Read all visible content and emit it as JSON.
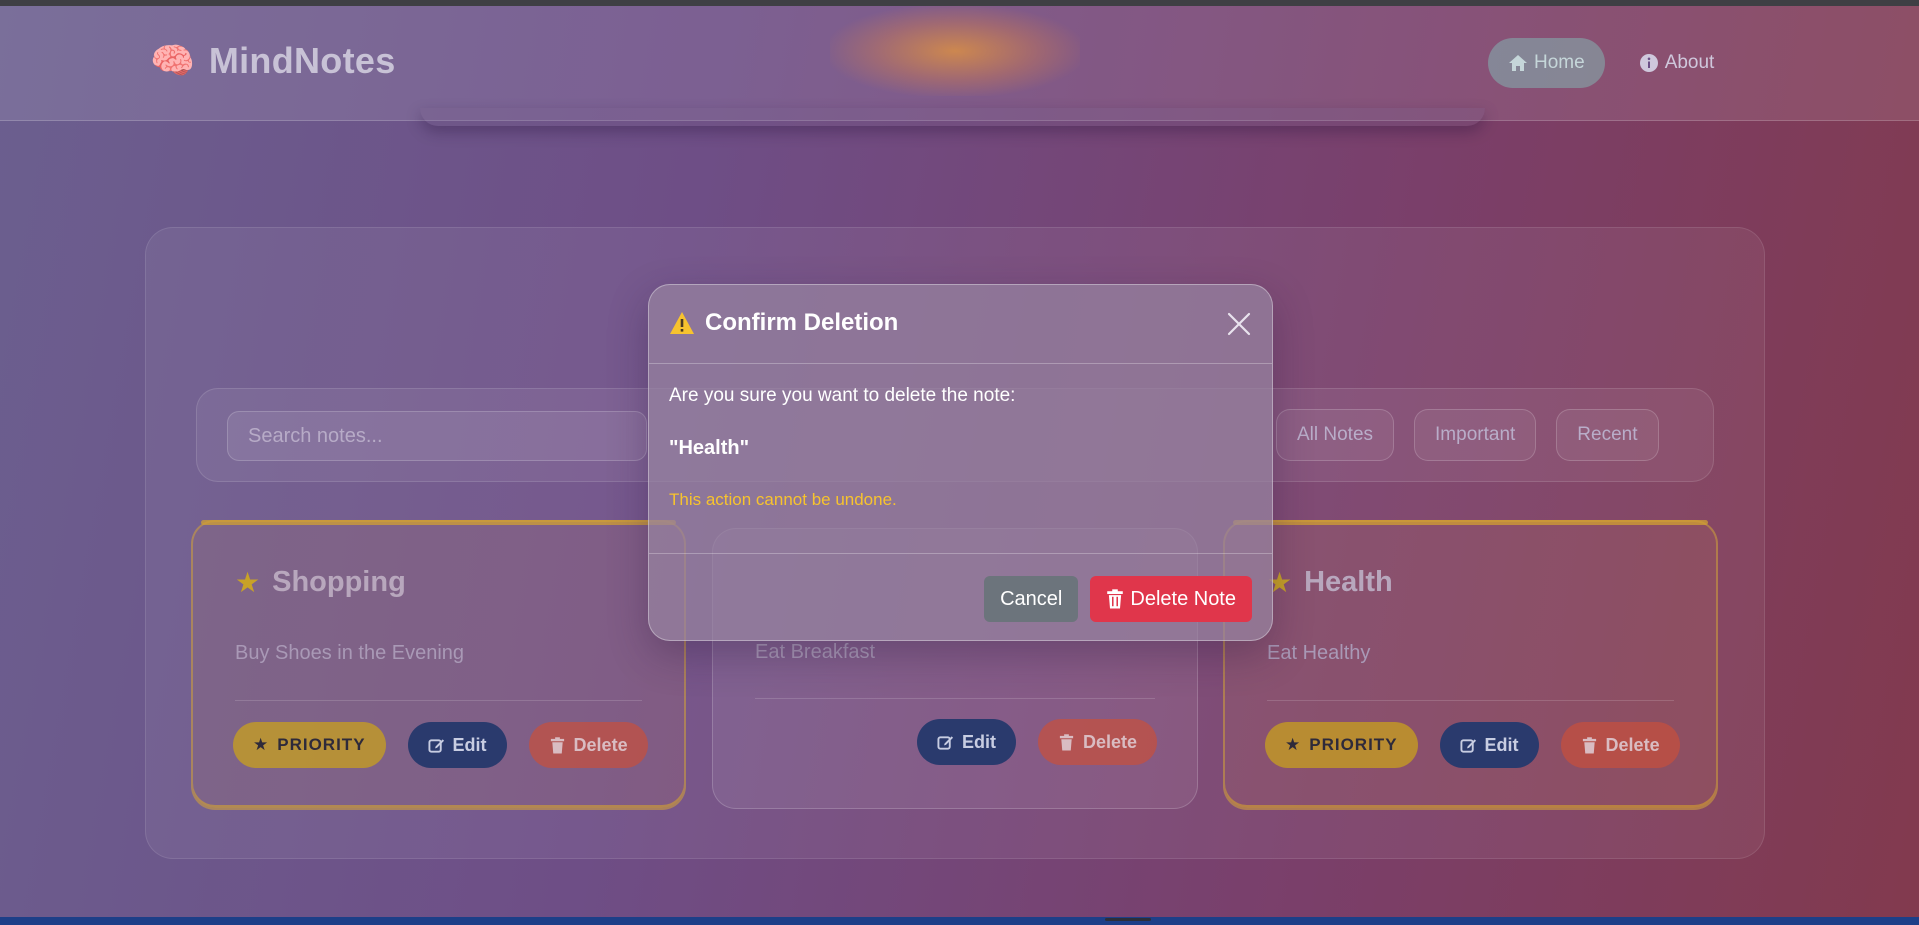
{
  "app": {
    "brand_name": "MindNotes",
    "brand_icon": "🧠"
  },
  "nav": {
    "home_label": "Home",
    "about_label": "About"
  },
  "search": {
    "placeholder": "Search notes..."
  },
  "filters": [
    "All Notes",
    "Important",
    "Recent"
  ],
  "cards": [
    {
      "title": "Shopping",
      "body": "Buy Shoes in the Evening",
      "priority": true,
      "priority_label": "PRIORITY",
      "edit_label": "Edit",
      "delete_label": "Delete"
    },
    {
      "title": "",
      "body": "Eat Breakfast",
      "priority": false,
      "edit_label": "Edit",
      "delete_label": "Delete"
    },
    {
      "title": "Health",
      "body": "Eat Healthy",
      "priority": true,
      "priority_label": "PRIORITY",
      "edit_label": "Edit",
      "delete_label": "Delete"
    }
  ],
  "modal": {
    "title": "Confirm Deletion",
    "question": "Are you sure you want to delete the note:",
    "note_name": "\"Health\"",
    "warning": "This action cannot be undone.",
    "cancel_label": "Cancel",
    "confirm_label": "Delete Note"
  },
  "colors": {
    "danger": "#e0364b",
    "warning": "#f7c32e",
    "cancel": "#6c747c",
    "edit": "#2a3a6d",
    "priority": "#c8a01e"
  }
}
